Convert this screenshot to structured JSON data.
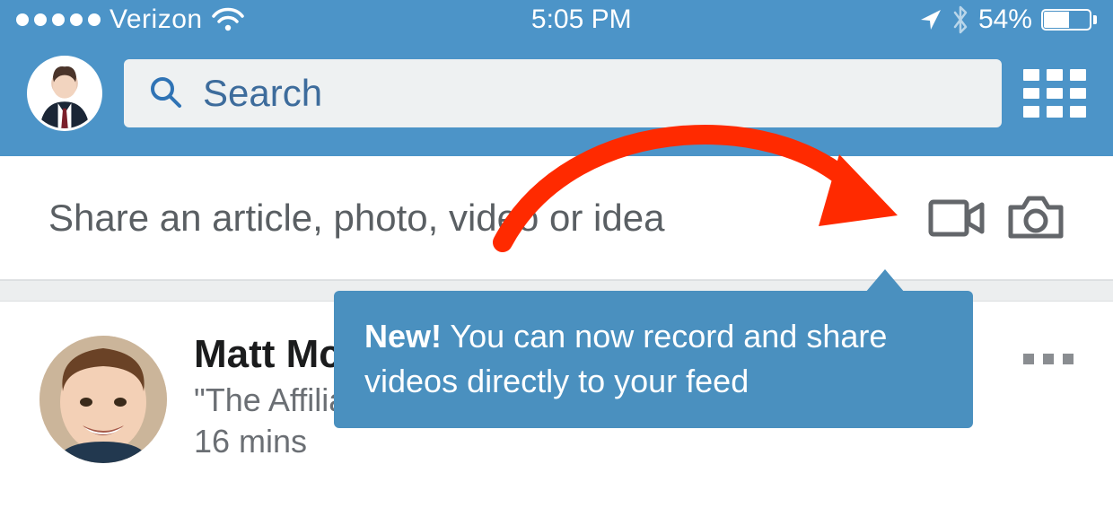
{
  "status": {
    "carrier": "Verizon",
    "time": "5:05 PM",
    "battery_pct": "54%"
  },
  "header": {
    "search_placeholder": "Search"
  },
  "composer": {
    "prompt": "Share an article, photo, video or idea"
  },
  "tooltip": {
    "tag": "New!",
    "text": "You can now record and share videos directly to your feed"
  },
  "feed": {
    "items": [
      {
        "name": "Matt McW…",
        "headline": "\"The Affiliate Guy\" | Affiliate Marketing, Recruiting, &…",
        "time": "16 mins"
      }
    ]
  }
}
